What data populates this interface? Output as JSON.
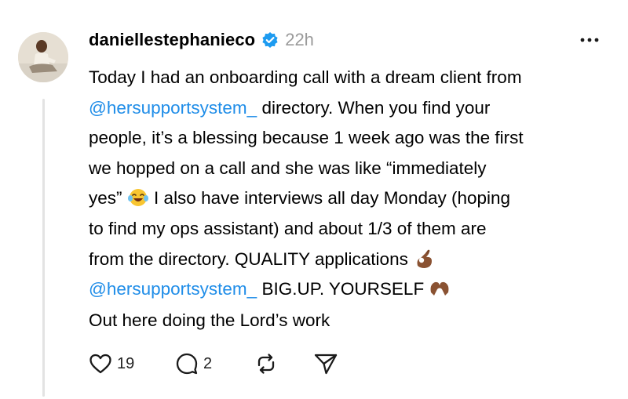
{
  "post": {
    "username": "daniellestephanieco",
    "timestamp": "22h",
    "verified_icon": "verified-badge-icon",
    "more_icon": "more-options-icon",
    "lines": [
      "Today I had an onboarding call with a dream client from",
      "directory. When you find your",
      "people, it’s a blessing because 1 week ago was the first",
      "we hopped on a call and she was like “immediately",
      "yes”",
      "I also have interviews all day Monday (hoping",
      "to find my ops assistant) and about 1/3 of them are",
      "from the directory. QUALITY applications",
      "BIG.UP. YOURSELF"
    ],
    "mention": "@hersupportsystem_",
    "closing": "Out here doing the Lord’s work",
    "emojis": [
      "laughing-tears-emoji",
      "ok-hand-emoji",
      "heart-hands-emoji"
    ]
  },
  "actions": {
    "like_count": "19",
    "reply_count": "2",
    "like_icon": "heart-icon",
    "reply_icon": "comment-icon",
    "repost_icon": "repost-icon",
    "share_icon": "share-icon"
  },
  "colors": {
    "mention": "#1f8de8",
    "verified": "#1d9bf0",
    "muted": "#9a9a9a"
  }
}
